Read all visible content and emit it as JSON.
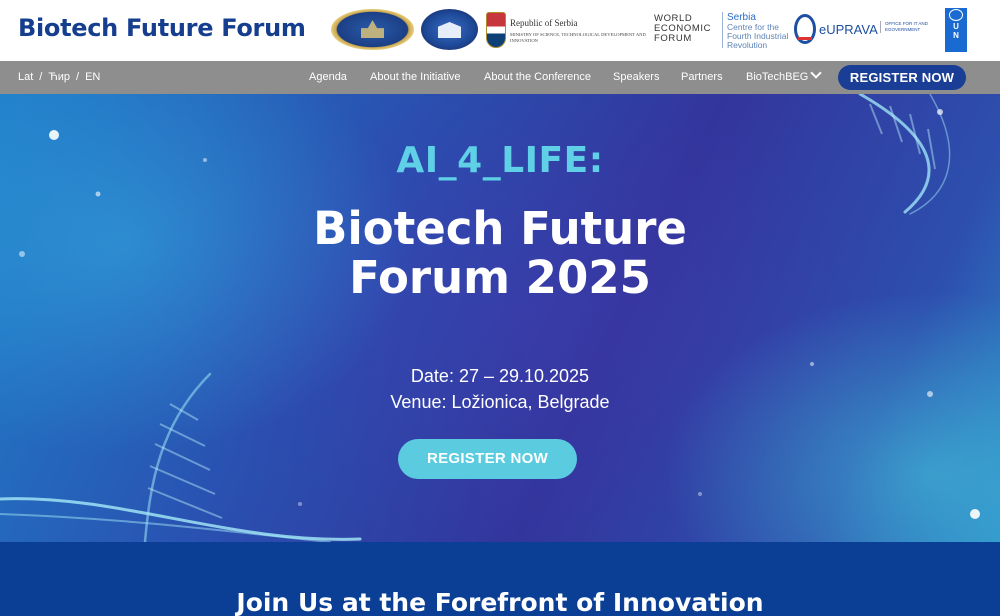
{
  "header": {
    "site_title": "Biotech Future Forum",
    "partners": {
      "serbia_title": "Republic of Serbia",
      "serbia_ministry": "Ministry of Science, Technological Development and Innovation",
      "wef": "WORLD ECONOMIC FORUM",
      "c4ir_title": "Serbia",
      "c4ir_sub": "Centre for the Fourth Industrial Revolution",
      "euprava": "eUPRAVA",
      "euprava_sub": "Office for IT and eGovernment",
      "undp": [
        "U",
        "N",
        "D",
        "P"
      ]
    }
  },
  "nav": {
    "languages": [
      "Lat",
      "Ћир",
      "EN"
    ],
    "items": [
      "Agenda",
      "About the Initiative",
      "About the Conference",
      "Speakers",
      "Partners",
      "BioTechBEG"
    ],
    "register_label": "REGISTER NOW"
  },
  "hero": {
    "kicker": "AI_4_LIFE:",
    "title_line1": "Biotech Future",
    "title_line2": "Forum 2025",
    "date": "Date: 27 – 29.10.2025",
    "venue": "Venue: Ložionica, Belgrade",
    "register_label": "REGISTER NOW"
  },
  "section": {
    "title": "Join Us at the Forefront of Innovation"
  },
  "colors": {
    "brand_blue": "#163e8f",
    "nav_gray": "#8e8e8e",
    "nav_button": "#1a3d96",
    "accent_cyan": "#5bcbe0",
    "section_blue": "#0b3f95"
  }
}
